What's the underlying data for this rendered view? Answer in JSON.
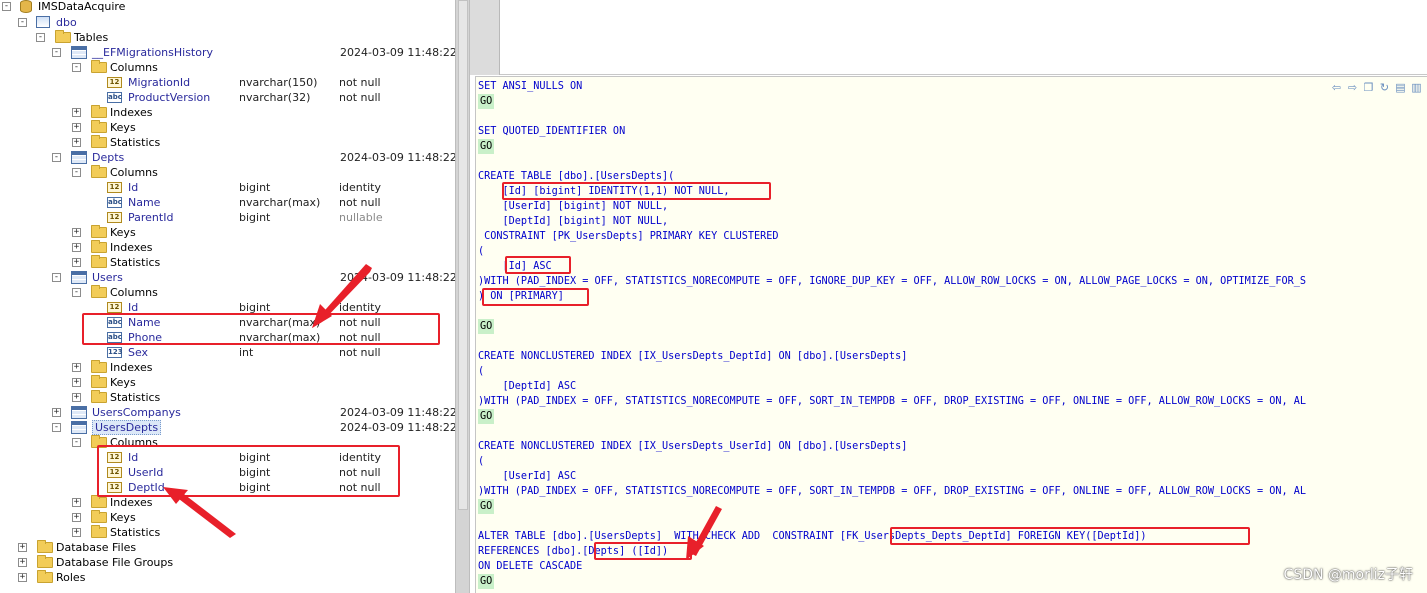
{
  "tree": {
    "server": "IMSDataAcquire",
    "schema": "dbo",
    "tables_folder": "Tables",
    "tables": [
      {
        "name": "__EFMigrationsHistory",
        "date": "2024-03-09 11:48:22",
        "columns": [
          {
            "name": "MigrationId",
            "type": "nvarchar(150)",
            "nullability": "not null",
            "icon": "key-column-icon"
          },
          {
            "name": "ProductVersion",
            "type": "nvarchar(32)",
            "nullability": "not null",
            "icon": "text-column-icon"
          }
        ]
      },
      {
        "name": "Depts",
        "date": "2024-03-09 11:48:22",
        "columns": [
          {
            "name": "Id",
            "type": "bigint",
            "nullability": "identity",
            "icon": "key-column-icon"
          },
          {
            "name": "Name",
            "type": "nvarchar(max)",
            "nullability": "not null",
            "icon": "text-column-icon"
          },
          {
            "name": "ParentId",
            "type": "bigint",
            "nullability": "nullable",
            "icon": "key-column-icon"
          }
        ]
      },
      {
        "name": "Users",
        "date": "2024-03-09 11:48:22",
        "columns": [
          {
            "name": "Id",
            "type": "bigint",
            "nullability": "identity",
            "icon": "key-column-icon"
          },
          {
            "name": "Name",
            "type": "nvarchar(max)",
            "nullability": "not null",
            "icon": "text-column-icon"
          },
          {
            "name": "Phone",
            "type": "nvarchar(max)",
            "nullability": "not null",
            "icon": "text-column-icon"
          },
          {
            "name": "Sex",
            "type": "int",
            "nullability": "not null",
            "icon": "number-column-icon"
          }
        ]
      },
      {
        "name": "UsersCompanys",
        "date": "2024-03-09 11:48:22"
      },
      {
        "name": "UsersDepts",
        "date": "2024-03-09 11:48:22",
        "columns": [
          {
            "name": "Id",
            "type": "bigint",
            "nullability": "identity",
            "icon": "key-column-icon"
          },
          {
            "name": "UserId",
            "type": "bigint",
            "nullability": "not null",
            "icon": "key-column-icon"
          },
          {
            "name": "DeptId",
            "type": "bigint",
            "nullability": "not null",
            "icon": "key-column-icon"
          }
        ]
      }
    ],
    "folder_labels": {
      "columns": "Columns",
      "indexes": "Indexes",
      "keys": "Keys",
      "statistics": "Statistics"
    },
    "bottom_folders": [
      "Database Files",
      "Database File Groups",
      "Roles"
    ],
    "icon_glyphs": {
      "text": "abc",
      "number": "123",
      "key": "12"
    }
  },
  "editor": {
    "lines": [
      "SET ANSI_NULLS ON",
      "GO",
      "",
      "SET QUOTED_IDENTIFIER ON",
      "GO",
      "",
      "CREATE TABLE [dbo].[UsersDepts](",
      "    [Id] [bigint] IDENTITY(1,1) NOT NULL,",
      "    [UserId] [bigint] NOT NULL,",
      "    [DeptId] [bigint] NOT NULL,",
      " CONSTRAINT [PK_UsersDepts] PRIMARY KEY CLUSTERED",
      "(",
      "    [Id] ASC",
      ")WITH (PAD_INDEX = OFF, STATISTICS_NORECOMPUTE = OFF, IGNORE_DUP_KEY = OFF, ALLOW_ROW_LOCKS = ON, ALLOW_PAGE_LOCKS = ON, OPTIMIZE_FOR_S",
      ") ON [PRIMARY]",
      "",
      "GO",
      "",
      "CREATE NONCLUSTERED INDEX [IX_UsersDepts_DeptId] ON [dbo].[UsersDepts]",
      "(",
      "    [DeptId] ASC",
      ")WITH (PAD_INDEX = OFF, STATISTICS_NORECOMPUTE = OFF, SORT_IN_TEMPDB = OFF, DROP_EXISTING = OFF, ONLINE = OFF, ALLOW_ROW_LOCKS = ON, AL",
      "GO",
      "",
      "CREATE NONCLUSTERED INDEX [IX_UsersDepts_UserId] ON [dbo].[UsersDepts]",
      "(",
      "    [UserId] ASC",
      ")WITH (PAD_INDEX = OFF, STATISTICS_NORECOMPUTE = OFF, SORT_IN_TEMPDB = OFF, DROP_EXISTING = OFF, ONLINE = OFF, ALLOW_ROW_LOCKS = ON, AL",
      "GO",
      "",
      "ALTER TABLE [dbo].[UsersDepts]  WITH CHECK ADD  CONSTRAINT [FK_UsersDepts_Depts_DeptId] FOREIGN KEY([DeptId])",
      "REFERENCES [dbo].[Depts] ([Id])",
      "ON DELETE CASCADE",
      "GO"
    ],
    "toolbar_icons": [
      "back-arrow-icon",
      "forward-arrow-icon",
      "copy-icon",
      "refresh-icon",
      "document-icon",
      "document-copy-icon"
    ]
  },
  "watermark": "CSDN @morliz子轩",
  "colors": {
    "highlight": "#e8202a",
    "keyword": "#0000cc",
    "go_bg": "#c9f0c9",
    "editor_bg": "#fffff2"
  }
}
